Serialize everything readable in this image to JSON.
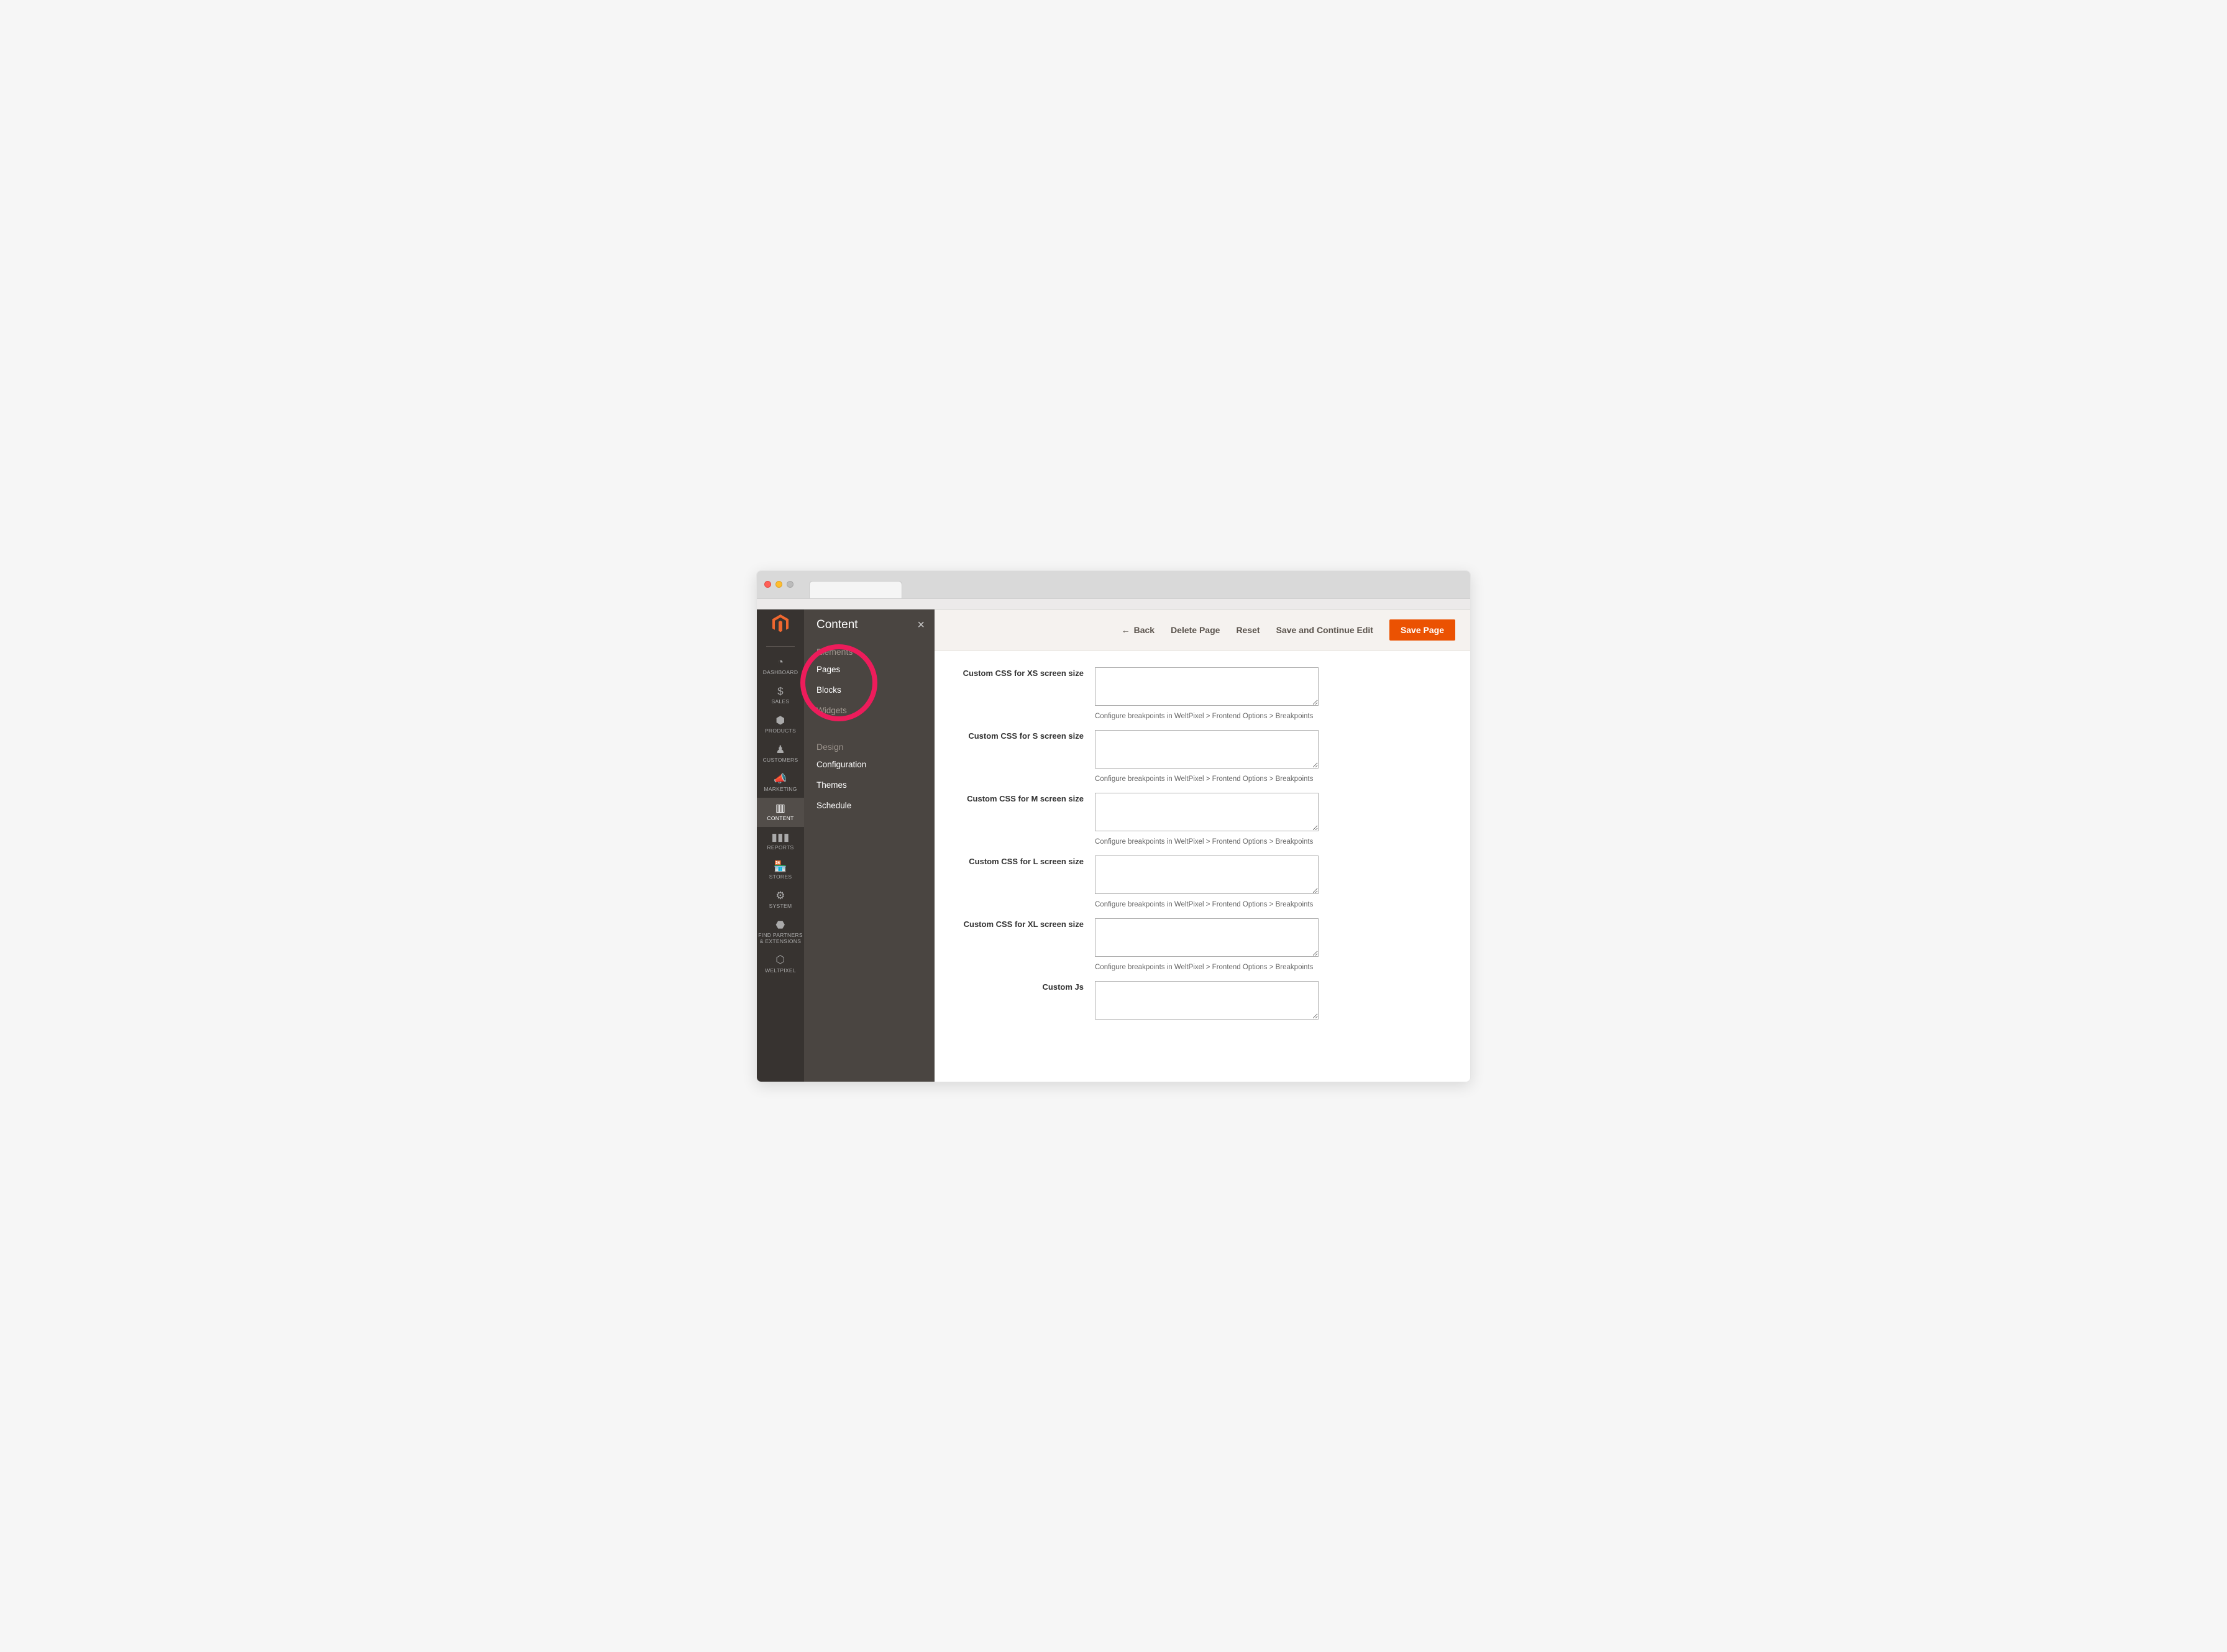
{
  "rail": {
    "items": [
      {
        "label": "DASHBOARD",
        "icon": "◔"
      },
      {
        "label": "SALES",
        "icon": "$"
      },
      {
        "label": "PRODUCTS",
        "icon": "⬢"
      },
      {
        "label": "CUSTOMERS",
        "icon": "♟"
      },
      {
        "label": "MARKETING",
        "icon": "📣"
      },
      {
        "label": "CONTENT",
        "icon": "▥"
      },
      {
        "label": "REPORTS",
        "icon": "▮▮▮"
      },
      {
        "label": "STORES",
        "icon": "🏪"
      },
      {
        "label": "SYSTEM",
        "icon": "⚙"
      },
      {
        "label": "FIND PARTNERS & EXTENSIONS",
        "icon": "⬣"
      },
      {
        "label": "WELTPIXEL",
        "icon": "⬡"
      }
    ],
    "active_index": 5
  },
  "flyout": {
    "title": "Content",
    "sections": [
      {
        "heading": "Elements",
        "links": [
          "Pages",
          "Blocks",
          "Widgets"
        ]
      },
      {
        "heading": "Design",
        "links": [
          "Configuration",
          "Themes",
          "Schedule"
        ]
      }
    ]
  },
  "header": {
    "back": "Back",
    "delete": "Delete Page",
    "reset": "Reset",
    "save_continue": "Save and Continue Edit",
    "save": "Save Page"
  },
  "form": {
    "hint": "Configure breakpoints in WeltPixel > Frontend Options > Breakpoints",
    "fields": [
      {
        "label": "Custom CSS for XS screen size",
        "has_hint": true
      },
      {
        "label": "Custom CSS for S screen size",
        "has_hint": true
      },
      {
        "label": "Custom CSS for M screen size",
        "has_hint": true
      },
      {
        "label": "Custom CSS for L screen size",
        "has_hint": true
      },
      {
        "label": "Custom CSS for XL screen size",
        "has_hint": true
      },
      {
        "label": "Custom Js",
        "has_hint": false
      }
    ]
  }
}
